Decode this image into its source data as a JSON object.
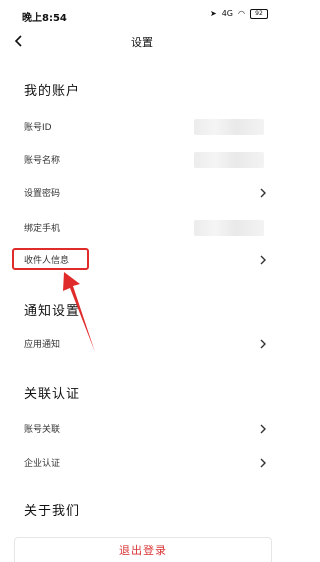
{
  "status_bar": {
    "time": "晚上8:54",
    "signal": "4G",
    "battery": "92"
  },
  "nav": {
    "title": "设置"
  },
  "sections": {
    "account": {
      "title": "我的账户",
      "items": [
        {
          "label": "账号ID",
          "value_hidden": true
        },
        {
          "label": "账号名称",
          "value_hidden": true
        },
        {
          "label": "设置密码",
          "has_chevron": true
        },
        {
          "label": "绑定手机",
          "value_hidden": true
        },
        {
          "label": "收件人信息",
          "has_chevron": true,
          "highlighted": true
        }
      ]
    },
    "notifications": {
      "title": "通知设置",
      "items": [
        {
          "label": "应用通知",
          "has_chevron": true
        }
      ]
    },
    "auth": {
      "title": "关联认证",
      "items": [
        {
          "label": "账号关联",
          "has_chevron": true
        },
        {
          "label": "企业认证",
          "has_chevron": true
        }
      ]
    },
    "about": {
      "title": "关于我们"
    }
  },
  "logout": {
    "label": "退出登录"
  },
  "colors": {
    "highlight": "#e02b2b",
    "logout_text": "#d93636"
  }
}
